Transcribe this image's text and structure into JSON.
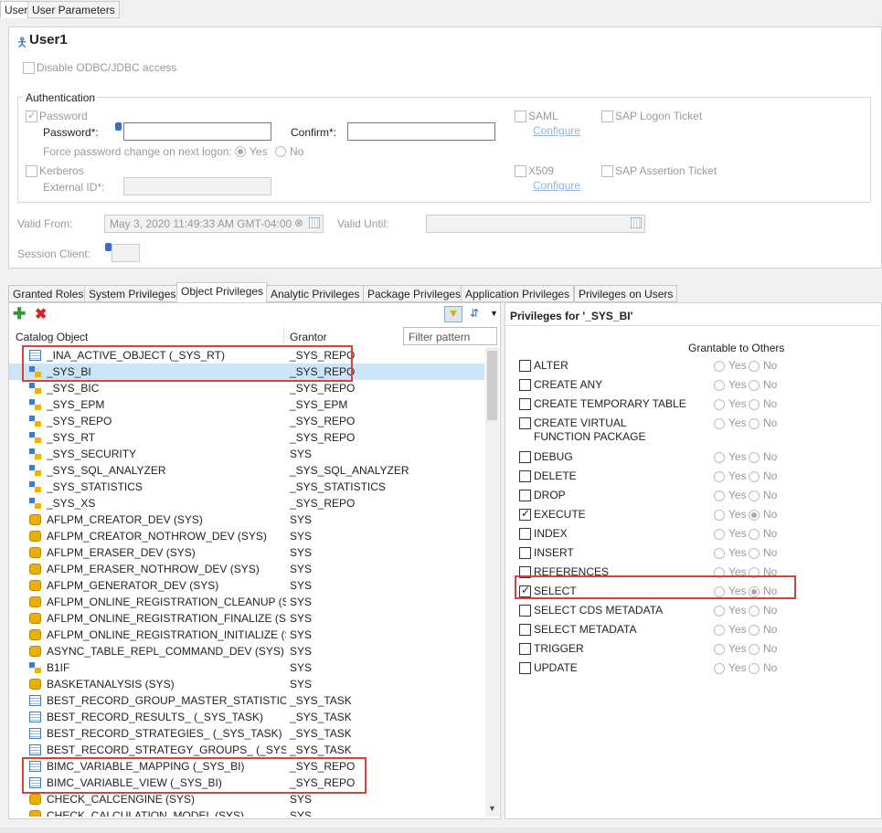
{
  "top_tabs": [
    "User",
    "User Parameters"
  ],
  "user": {
    "title": "User1",
    "disable_odbc": "Disable ODBC/JDBC access",
    "authentication_label": "Authentication",
    "password_cb": "Password",
    "password_label": "Password*:",
    "confirm_label": "Confirm*:",
    "force_change": "Force password change on next logon:",
    "yes": "Yes",
    "no": "No",
    "kerberos": "Kerberos",
    "external_id": "External ID*:",
    "saml": "SAML",
    "configure": "Configure",
    "x509": "X509",
    "sap_logon_ticket": "SAP Logon Ticket",
    "sap_assertion_ticket": "SAP Assertion Ticket",
    "valid_from_label": "Valid From:",
    "valid_from_value": "May 3, 2020 11:49:33 AM GMT-04:00",
    "valid_until_label": "Valid Until:",
    "session_client_label": "Session Client:"
  },
  "priv_tabs": [
    "Granted Roles",
    "System Privileges",
    "Object Privileges",
    "Analytic Privileges",
    "Package Privileges",
    "Application Privileges",
    "Privileges on Users"
  ],
  "catalog": {
    "col_object": "Catalog Object",
    "col_grantor": "Grantor",
    "filter_placeholder": "Filter pattern",
    "rows": [
      {
        "name": "_INA_ACTIVE_OBJECT (_SYS_RT)",
        "grantor": "_SYS_REPO",
        "icon": "table"
      },
      {
        "name": "_SYS_BI",
        "grantor": "_SYS_REPO",
        "icon": "schema"
      },
      {
        "name": "_SYS_BIC",
        "grantor": "_SYS_REPO",
        "icon": "schema"
      },
      {
        "name": "_SYS_EPM",
        "grantor": "_SYS_EPM",
        "icon": "schema"
      },
      {
        "name": "_SYS_REPO",
        "grantor": "_SYS_REPO",
        "icon": "schema"
      },
      {
        "name": "_SYS_RT",
        "grantor": "_SYS_REPO",
        "icon": "schema"
      },
      {
        "name": "_SYS_SECURITY",
        "grantor": "SYS",
        "icon": "schema"
      },
      {
        "name": "_SYS_SQL_ANALYZER",
        "grantor": "_SYS_SQL_ANALYZER",
        "icon": "schema"
      },
      {
        "name": "_SYS_STATISTICS",
        "grantor": "_SYS_STATISTICS",
        "icon": "schema"
      },
      {
        "name": "_SYS_XS",
        "grantor": "_SYS_REPO",
        "icon": "schema"
      },
      {
        "name": "AFLPM_CREATOR_DEV (SYS)",
        "grantor": "SYS",
        "icon": "proc"
      },
      {
        "name": "AFLPM_CREATOR_NOTHROW_DEV (SYS)",
        "grantor": "SYS",
        "icon": "proc"
      },
      {
        "name": "AFLPM_ERASER_DEV (SYS)",
        "grantor": "SYS",
        "icon": "proc"
      },
      {
        "name": "AFLPM_ERASER_NOTHROW_DEV (SYS)",
        "grantor": "SYS",
        "icon": "proc"
      },
      {
        "name": "AFLPM_GENERATOR_DEV (SYS)",
        "grantor": "SYS",
        "icon": "proc"
      },
      {
        "name": "AFLPM_ONLINE_REGISTRATION_CLEANUP (SYS)",
        "grantor": "SYS",
        "icon": "proc"
      },
      {
        "name": "AFLPM_ONLINE_REGISTRATION_FINALIZE (SYS)",
        "grantor": "SYS",
        "icon": "proc"
      },
      {
        "name": "AFLPM_ONLINE_REGISTRATION_INITIALIZE (SYS)",
        "grantor": "SYS",
        "icon": "proc"
      },
      {
        "name": "ASYNC_TABLE_REPL_COMMAND_DEV (SYS)",
        "grantor": "SYS",
        "icon": "proc"
      },
      {
        "name": "B1IF",
        "grantor": "SYS",
        "icon": "schema"
      },
      {
        "name": "BASKETANALYSIS (SYS)",
        "grantor": "SYS",
        "icon": "proc"
      },
      {
        "name": "BEST_RECORD_GROUP_MASTER_STATISTICS_ (_SYS_TASK)",
        "grantor": "_SYS_TASK",
        "icon": "table"
      },
      {
        "name": "BEST_RECORD_RESULTS_ (_SYS_TASK)",
        "grantor": "_SYS_TASK",
        "icon": "table"
      },
      {
        "name": "BEST_RECORD_STRATEGIES_ (_SYS_TASK)",
        "grantor": "_SYS_TASK",
        "icon": "table"
      },
      {
        "name": "BEST_RECORD_STRATEGY_GROUPS_ (_SYS_TASK)",
        "grantor": "_SYS_TASK",
        "icon": "table"
      },
      {
        "name": "BIMC_VARIABLE_MAPPING (_SYS_BI)",
        "grantor": "_SYS_REPO",
        "icon": "table"
      },
      {
        "name": "BIMC_VARIABLE_VIEW (_SYS_BI)",
        "grantor": "_SYS_REPO",
        "icon": "table"
      },
      {
        "name": "CHECK_CALCENGINE (SYS)",
        "grantor": "SYS",
        "icon": "proc"
      },
      {
        "name": "CHECK_CALCULATION_MODEL (SYS)",
        "grantor": "SYS",
        "icon": "proc"
      }
    ]
  },
  "privileges": {
    "title": "Privileges for '_SYS_BI'",
    "grantable": "Grantable to Others",
    "yes": "Yes",
    "no": "No",
    "items": [
      {
        "label": "ALTER",
        "checked": false
      },
      {
        "label": "CREATE ANY",
        "checked": false
      },
      {
        "label": "CREATE TEMPORARY TABLE",
        "checked": false
      },
      {
        "label": "CREATE VIRTUAL FUNCTION PACKAGE",
        "checked": false
      },
      {
        "label": "DEBUG",
        "checked": false
      },
      {
        "label": "DELETE",
        "checked": false
      },
      {
        "label": "DROP",
        "checked": false
      },
      {
        "label": "EXECUTE",
        "checked": true
      },
      {
        "label": "INDEX",
        "checked": false
      },
      {
        "label": "INSERT",
        "checked": false
      },
      {
        "label": "REFERENCES",
        "checked": false
      },
      {
        "label": "SELECT",
        "checked": true
      },
      {
        "label": "SELECT CDS METADATA",
        "checked": false
      },
      {
        "label": "SELECT METADATA",
        "checked": false
      },
      {
        "label": "TRIGGER",
        "checked": false
      },
      {
        "label": "UPDATE",
        "checked": false
      }
    ]
  }
}
